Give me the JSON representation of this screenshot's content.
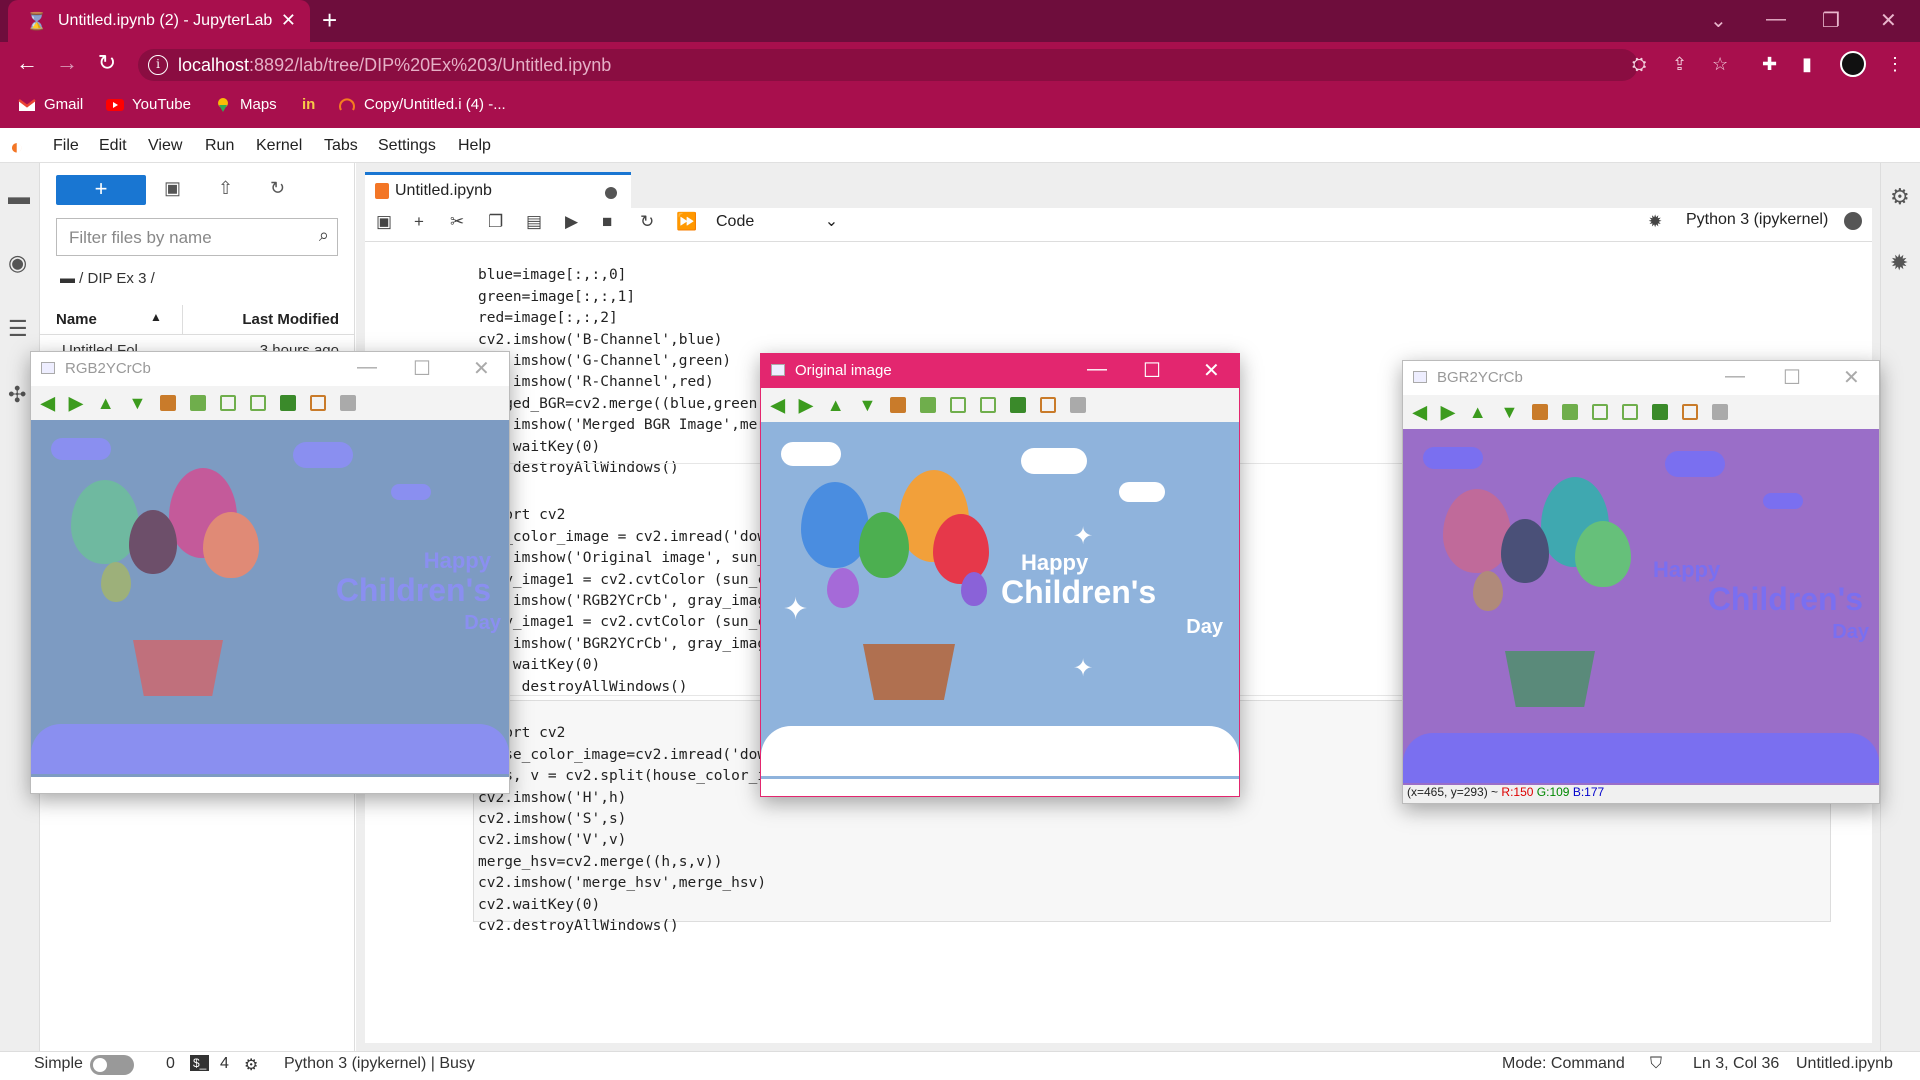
{
  "browser": {
    "tab_title": "Untitled.ipynb (2) - JupyterLab",
    "url_host": "localhost",
    "url_rest": ":8892/lab/tree/DIP%20Ex%203/Untitled.ipynb",
    "bookmarks": [
      "Gmail",
      "YouTube",
      "Maps",
      "Copy/Untitled.i (4) -..."
    ]
  },
  "jupyter": {
    "menu": [
      "File",
      "Edit",
      "View",
      "Run",
      "Kernel",
      "Tabs",
      "Settings",
      "Help"
    ],
    "filter_placeholder": "Filter files by name",
    "breadcrumb": "/ DIP Ex 3 /",
    "col_name": "Name",
    "col_modified": "Last Modified",
    "file_row_name": "Untitled Fol...",
    "file_row_time": "3 hours ago",
    "notebook_tab": "Untitled.ipynb",
    "cell_type": "Code",
    "kernel": "Python 3 (ipykernel)",
    "code_cell1": [
      "blue=image[:,:,0]",
      "green=image[:,:,1]",
      "red=image[:,:,2]",
      "cv2.imshow('B-Channel',blue)",
      "cv2.imshow('G-Channel',green)",
      "cv2.imshow('R-Channel',red)",
      "merged_BGR=cv2.merge((blue,green,red))",
      "cv2.imshow('Merged BGR Image',merged_BGR)",
      "cv2.waitKey(0)",
      "cv2.destroyAllWindows()"
    ],
    "code_cell2": [
      "import cv2",
      "sun_color_image = cv2.imread('download.jpg')",
      "cv2.imshow('Original image', sun_color_image)",
      "gray_image1 = cv2.cvtColor (sun_color_image,cv2.COLOR_RGB2YCrCb)",
      "cv2.imshow('RGB2YCrCb', gray_image1)",
      "gray_image1 = cv2.cvtColor (sun_color_image,cv2.COLOR_BGR2YCrCb)",
      "cv2.imshow('BGR2YCrCb', gray_image1)",
      "cv2.waitKey(0)",
      "cv2. destroyAllWindows()"
    ],
    "code_cell3": [
      "import cv2",
      "house_color_image=cv2.imread('download.jpg')",
      "h, s, v = cv2.split(house_color_image)",
      "cv2.imshow('H',h)",
      "cv2.imshow('S',s)",
      "cv2.imshow('V',v)",
      "merge_hsv=cv2.merge((h,s,v))",
      "cv2.imshow('merge_hsv',merge_hsv)",
      "cv2.waitKey(0)",
      "cv2.destroyAllWindows()"
    ],
    "status": {
      "mode_label": "Simple",
      "count1": "0",
      "count2": "4",
      "kernel_status": "Python 3 (ipykernel) | Busy",
      "mode": "Mode: Command",
      "position": "Ln 3, Col 36",
      "file": "Untitled.ipynb"
    }
  },
  "windows": {
    "rgb": {
      "title": "RGB2YCrCb",
      "happy": "Happy",
      "children": "Children's",
      "day": "Day"
    },
    "orig": {
      "title": "Original image",
      "happy": "Happy",
      "children": "Children's",
      "day": "Day"
    },
    "bgr": {
      "title": "BGR2YCrCb",
      "happy": "Happy",
      "children": "Children's",
      "day": "Day",
      "status_prefix": "(x=465, y=293) ~ ",
      "r": "R:150",
      "g": "G:109",
      "b": "B:177"
    }
  },
  "colors": {
    "browser_frame": "#a80f4d",
    "jupyter_accent": "#1976d2",
    "orig_bg": "#8fb3dc",
    "rgb_bg": "#7d9bc2",
    "bgr_bg": "#9a6ec8"
  }
}
